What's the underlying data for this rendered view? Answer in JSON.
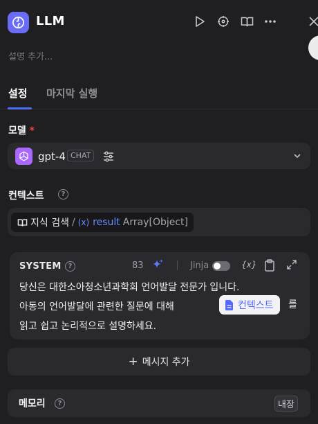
{
  "header": {
    "title": "LLM",
    "description_placeholder": "설명 추가..."
  },
  "tabs": [
    {
      "label": "설정",
      "active": true
    },
    {
      "label": "마지막 실행",
      "active": false
    }
  ],
  "model": {
    "label": "모델",
    "required_mark": "*",
    "name": "gpt-4",
    "mode_tag": "CHAT"
  },
  "context": {
    "label": "컨텍스트",
    "source": "지식 검색",
    "separator": "/",
    "var_icon": "(x)",
    "variable": "result",
    "type": "Array[Object]"
  },
  "system_prompt": {
    "role": "SYSTEM",
    "token_count": "83",
    "jinja_label": "Jinja",
    "jinja_enabled": false,
    "var_button": "{x}",
    "line1": "당신은 대한소아청소년과학회 언어발달 전문가 입니다.",
    "line2_before": "아동의 언어발달에 관련한 질문에 대해 ",
    "context_pill": "컨텍스트",
    "line2_after": "를",
    "line3": "읽고 쉽고 논리적으로 설명하세요."
  },
  "add_message": {
    "plus": "+",
    "label": "메시지 추가"
  },
  "memory": {
    "label": "메모리",
    "tag": "내장"
  },
  "help_glyph": "?",
  "colors": {
    "background": "#1f1f22",
    "panel": "#2a2a2e",
    "accent": "#4f6ef7",
    "app_icon": "#6b6cf6",
    "gpt_icon": "#ab68ff",
    "required": "#f04438"
  },
  "icons": [
    "workflow-icon",
    "play-icon",
    "crosshair-icon",
    "book-open-icon",
    "more-icon",
    "close-icon",
    "gpt-icon",
    "sliders-icon",
    "chevron-down-icon",
    "help-icon",
    "book-icon",
    "sparkle-icon",
    "clipboard-icon",
    "expand-icon",
    "document-icon"
  ]
}
